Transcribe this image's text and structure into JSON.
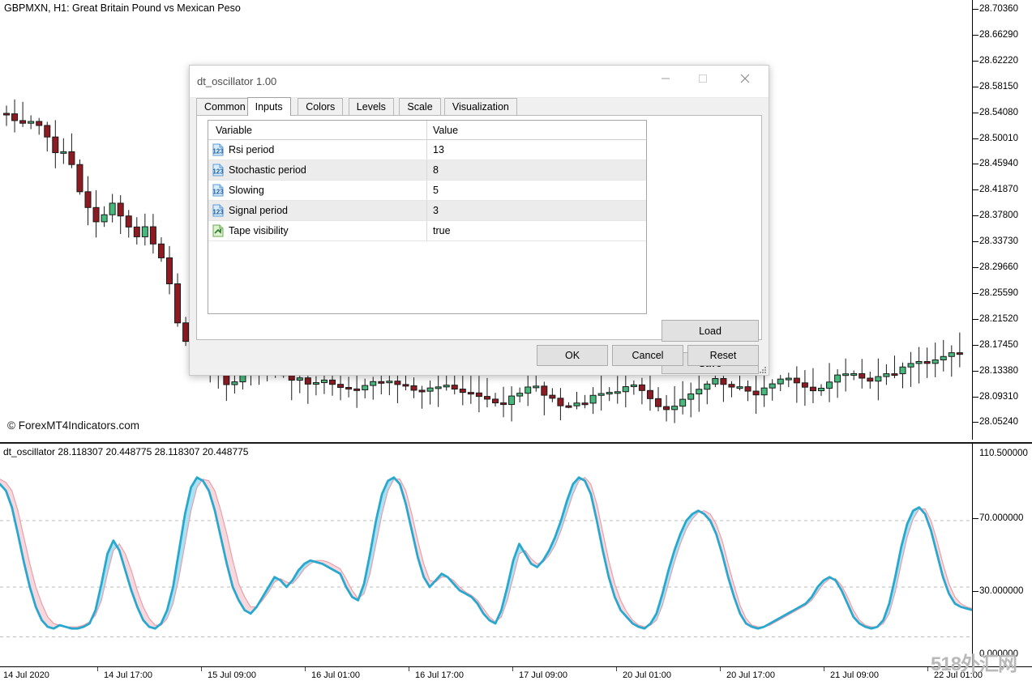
{
  "chart": {
    "symbol_label": "GBPMXN, H1:  Great Britain Pound vs Mexican Peso",
    "copyright": "© ForexMT4Indicators.com",
    "watermark": "518外汇网",
    "price_axis_ticks": [
      "28.70360",
      "28.66290",
      "28.62220",
      "28.58150",
      "28.54080",
      "28.50010",
      "28.45940",
      "28.41870",
      "28.37800",
      "28.33730",
      "28.29660",
      "28.25590",
      "28.21520",
      "28.17450",
      "28.13380",
      "28.09310",
      "28.05240"
    ],
    "time_axis_ticks": [
      "14 Jul 2020",
      "14 Jul 17:00",
      "15 Jul 09:00",
      "16 Jul 01:00",
      "16 Jul 17:00",
      "17 Jul 09:00",
      "20 Jul 01:00",
      "20 Jul 17:00",
      "21 Jul 09:00",
      "22 Jul 01:00"
    ],
    "colors": {
      "bull_candle": "#48b97c",
      "bear_candle": "#8e1b22",
      "candle_outline": "#1a1a1a",
      "main_line": "#29a8cf",
      "signal_line": "#e8a0ab",
      "fill_up": "#a9e0f2",
      "fill_down": "#f7d7dc",
      "level_line": "#bdbdbd"
    }
  },
  "indicator": {
    "label": "dt_oscillator 28.118307 20.448775 28.118307 20.448775",
    "axis_ticks": [
      "110.500000",
      "70.000000",
      "30.000000",
      "0.000000"
    ],
    "levels": [
      70,
      30
    ]
  },
  "chart_data": {
    "type": "line",
    "title": "dt_oscillator",
    "xlabel": "",
    "ylabel": "",
    "ylim": [
      -10.5,
      110.5
    ],
    "grid": true,
    "legend": "none",
    "x": [
      "14 Jul 2020",
      "14 Jul 17:00",
      "15 Jul 09:00",
      "16 Jul 01:00",
      "16 Jul 17:00",
      "17 Jul 09:00",
      "20 Jul 01:00",
      "20 Jul 17:00",
      "21 Jul 09:00",
      "22 Jul 01:00"
    ],
    "levels": [
      70,
      30
    ],
    "series": [
      {
        "name": "main",
        "color": "#29a8cf",
        "values": [
          92,
          88,
          78,
          62,
          45,
          30,
          18,
          10,
          6,
          5,
          7,
          6,
          5,
          5,
          6,
          8,
          16,
          32,
          50,
          58,
          52,
          40,
          28,
          18,
          10,
          6,
          5,
          8,
          16,
          30,
          52,
          74,
          90,
          96,
          94,
          88,
          76,
          60,
          44,
          30,
          22,
          16,
          14,
          18,
          24,
          30,
          36,
          34,
          30,
          34,
          40,
          44,
          46,
          45,
          44,
          42,
          40,
          38,
          30,
          24,
          22,
          32,
          50,
          70,
          86,
          94,
          96,
          92,
          80,
          64,
          48,
          36,
          30,
          34,
          38,
          36,
          32,
          28,
          26,
          24,
          20,
          14,
          10,
          8,
          16,
          30,
          46,
          56,
          50,
          44,
          42,
          46,
          52,
          60,
          70,
          82,
          92,
          96,
          94,
          86,
          70,
          52,
          36,
          24,
          16,
          12,
          8,
          6,
          5,
          8,
          14,
          26,
          40,
          52,
          62,
          70,
          74,
          76,
          74,
          70,
          62,
          50,
          36,
          24,
          14,
          8,
          6,
          5,
          6,
          8,
          10,
          12,
          14,
          16,
          18,
          20,
          24,
          30,
          34,
          36,
          34,
          28,
          20,
          12,
          8,
          6,
          5,
          6,
          10,
          20,
          36,
          54,
          68,
          76,
          78,
          74,
          64,
          50,
          36,
          26,
          20,
          18,
          17,
          16
        ]
      },
      {
        "name": "signal",
        "color": "#e8a0ab",
        "values": [
          95,
          93,
          88,
          76,
          60,
          44,
          30,
          20,
          12,
          8,
          7,
          6,
          6,
          6,
          7,
          9,
          13,
          22,
          38,
          52,
          56,
          50,
          40,
          28,
          18,
          11,
          7,
          7,
          11,
          20,
          36,
          56,
          76,
          90,
          95,
          94,
          88,
          76,
          62,
          46,
          32,
          24,
          18,
          18,
          22,
          27,
          33,
          35,
          33,
          32,
          36,
          41,
          44,
          46,
          46,
          45,
          43,
          41,
          35,
          28,
          23,
          26,
          38,
          56,
          74,
          88,
          95,
          95,
          88,
          74,
          58,
          44,
          34,
          33,
          36,
          36,
          34,
          30,
          27,
          25,
          22,
          17,
          12,
          9,
          12,
          22,
          36,
          50,
          52,
          47,
          44,
          45,
          49,
          55,
          64,
          75,
          86,
          94,
          96,
          92,
          80,
          63,
          46,
          32,
          22,
          15,
          10,
          7,
          6,
          7,
          10,
          19,
          32,
          45,
          56,
          65,
          71,
          75,
          76,
          74,
          68,
          58,
          44,
          31,
          19,
          11,
          7,
          6,
          6,
          7,
          9,
          11,
          13,
          15,
          17,
          19,
          22,
          27,
          32,
          35,
          35,
          31,
          24,
          16,
          10,
          7,
          6,
          6,
          8,
          14,
          27,
          44,
          60,
          71,
          77,
          77,
          70,
          58,
          44,
          32,
          24,
          20,
          18,
          17
        ]
      }
    ]
  },
  "dialog": {
    "title": "dt_oscillator 1.00",
    "window_controls": [
      {
        "name": "minimize-button",
        "glyph": "minimize"
      },
      {
        "name": "maximize-button",
        "glyph": "maximize"
      },
      {
        "name": "close-button",
        "glyph": "close"
      }
    ],
    "tabs": [
      {
        "label": "Common",
        "active": false
      },
      {
        "label": "Inputs",
        "active": true
      },
      {
        "label": "Colors",
        "active": false
      },
      {
        "label": "Levels",
        "active": false
      },
      {
        "label": "Scale",
        "active": false
      },
      {
        "label": "Visualization",
        "active": false
      }
    ],
    "grid": {
      "headers": [
        "Variable",
        "Value"
      ],
      "rows": [
        {
          "icon": "number-icon",
          "variable": "Rsi period",
          "value": "13"
        },
        {
          "icon": "number-icon",
          "variable": "Stochastic period",
          "value": "8"
        },
        {
          "icon": "number-icon",
          "variable": "Slowing",
          "value": "5"
        },
        {
          "icon": "number-icon",
          "variable": "Signal period",
          "value": "3"
        },
        {
          "icon": "boolean-icon",
          "variable": "Tape visibility",
          "value": "true"
        }
      ]
    },
    "side_buttons": [
      {
        "name": "load-button",
        "label": "Load"
      },
      {
        "name": "save-button",
        "label": "Save"
      }
    ],
    "bottom_buttons": [
      {
        "name": "ok-button",
        "label": "OK"
      },
      {
        "name": "cancel-button",
        "label": "Cancel"
      },
      {
        "name": "reset-button",
        "label": "Reset"
      }
    ]
  }
}
